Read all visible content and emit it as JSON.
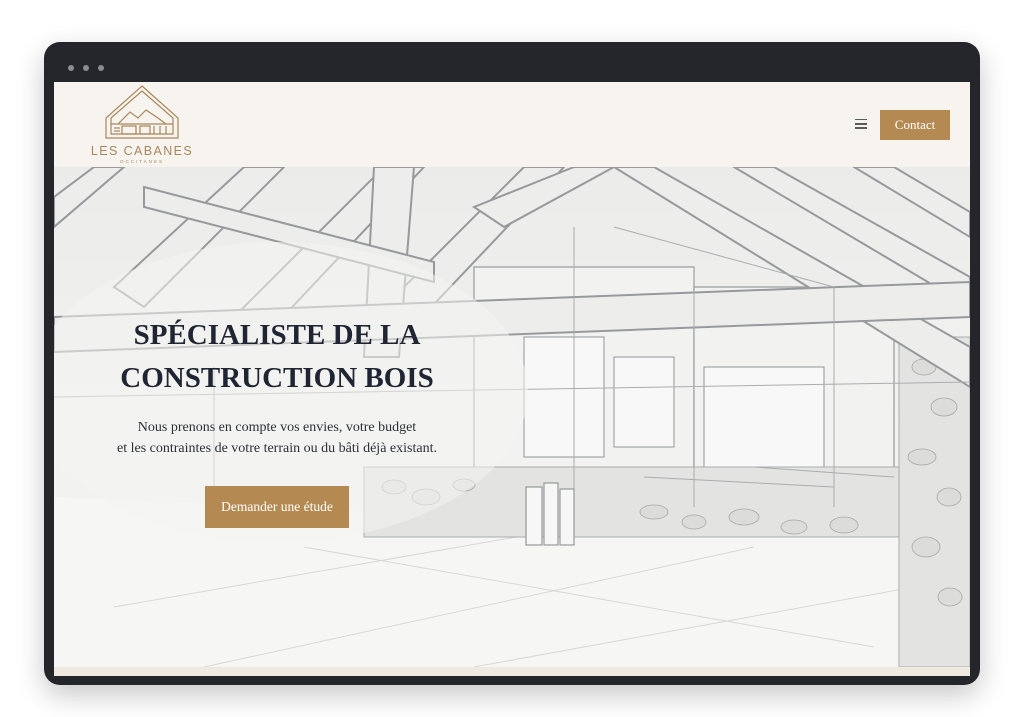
{
  "brand": {
    "name": "LES CABANES",
    "tagline": "OCCITANES",
    "logo_icon": "cabin-roof-logo",
    "accent_color": "#b58a52",
    "logo_color": "#a8875a"
  },
  "nav": {
    "menu_icon": "hamburger-menu-icon",
    "contact_label": "Contact"
  },
  "hero": {
    "title_line1": "SPÉCIALISTE DE LA",
    "title_line2": "CONSTRUCTION BOIS",
    "text_line1": "Nous prenons en compte vos envies, votre budget",
    "text_line2": "et les contraintes de votre terrain ou du bâti déjà existant.",
    "cta_label": "Demander une étude",
    "background": "timber-frame-interior-sketch"
  }
}
